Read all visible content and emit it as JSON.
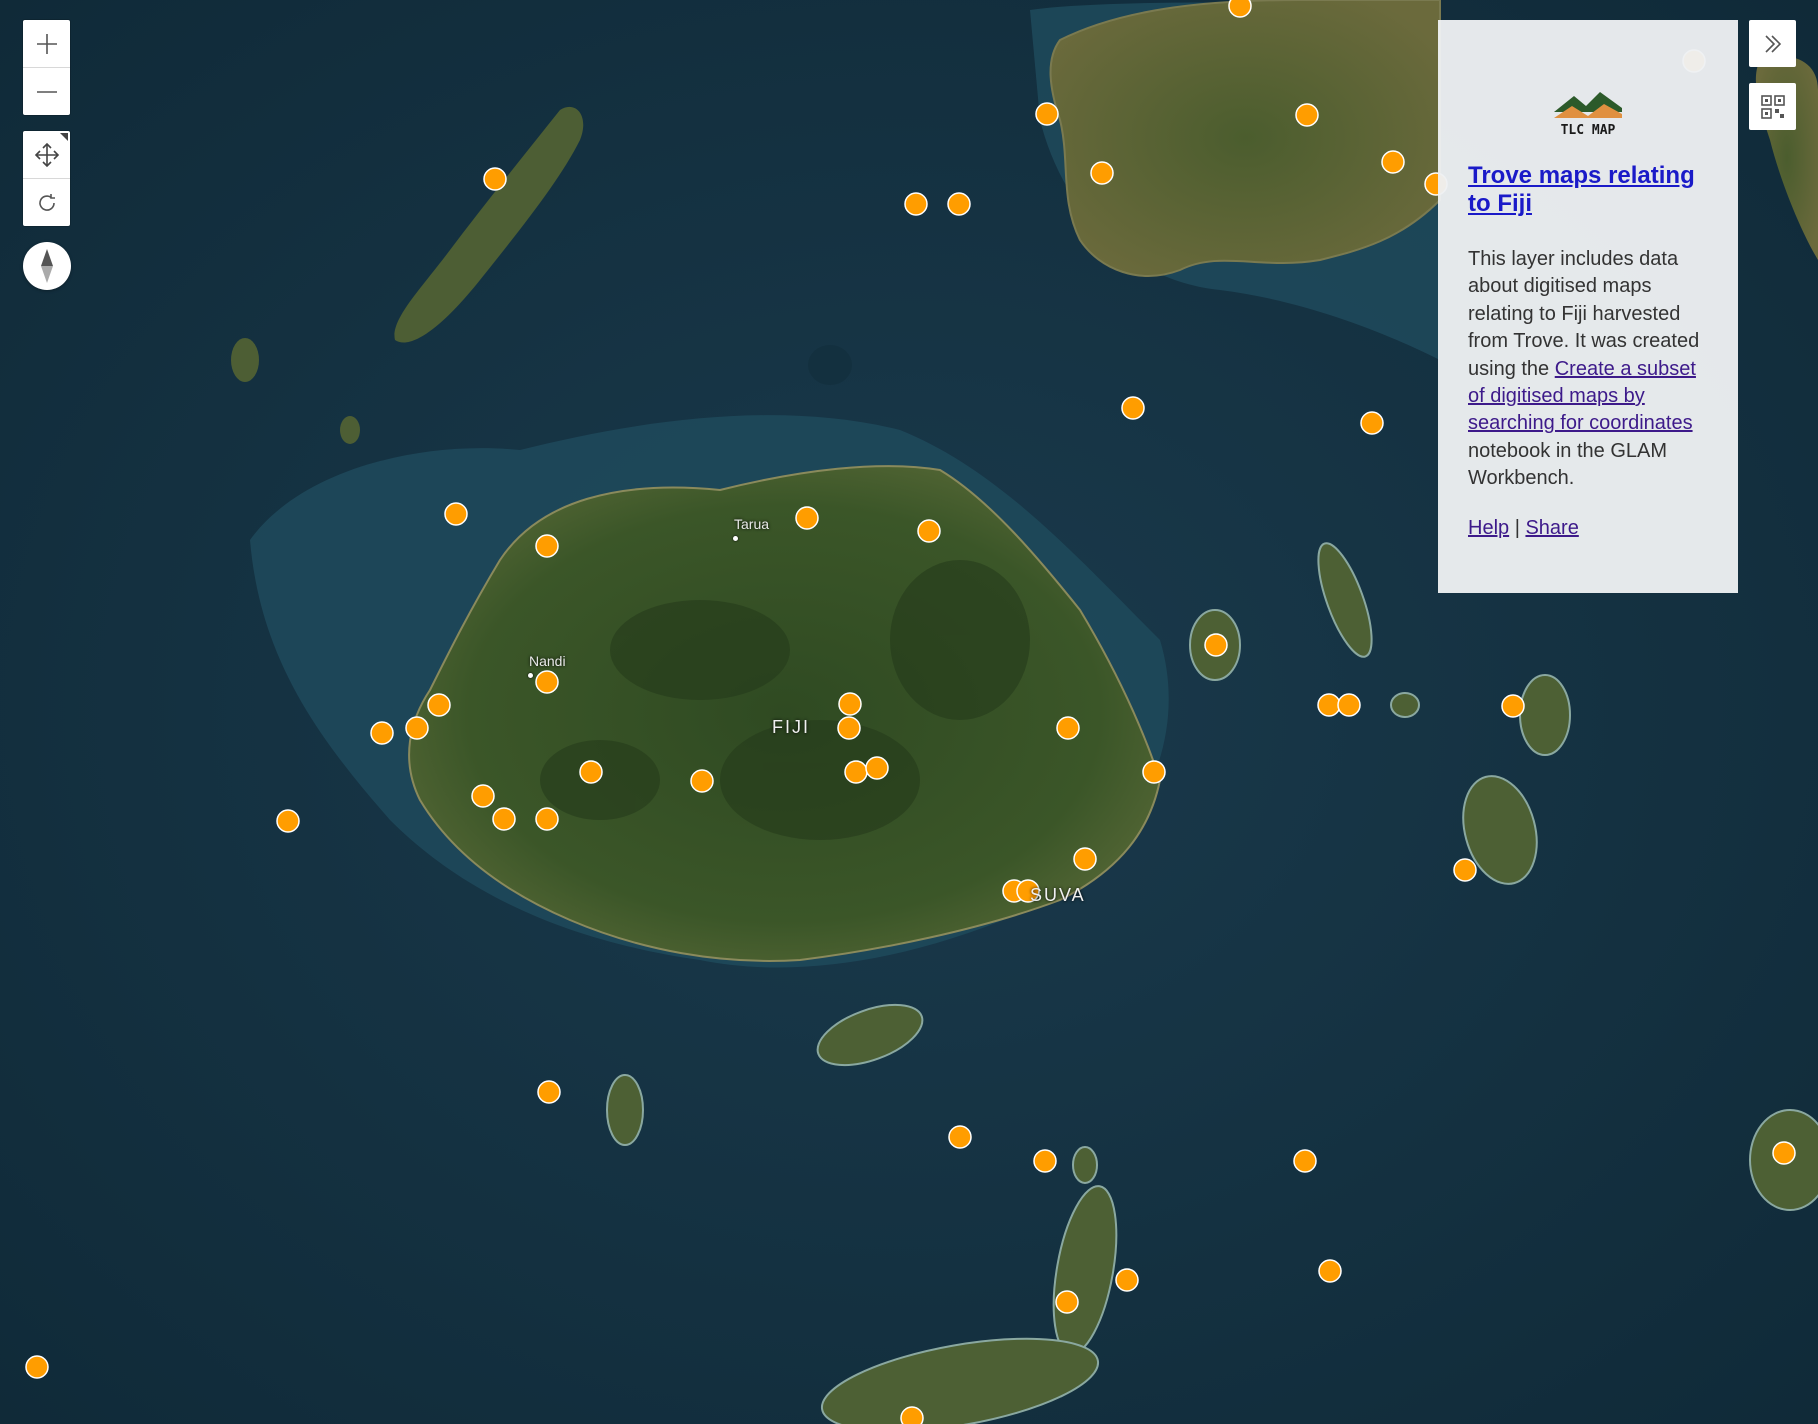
{
  "map": {
    "labels": {
      "tarua": "Tarua",
      "nandi": "Nandi",
      "fiji": "FIJI",
      "suva": "SUVA"
    },
    "marker_color": "#ff9d00",
    "marker_count": 53
  },
  "controls": {
    "zoom_in_icon": "plus-icon",
    "zoom_out_icon": "minus-icon",
    "pan_icon": "move-arrows-icon",
    "rotate_icon": "rotate-icon",
    "compass_icon": "compass-needle-icon",
    "collapse_icon": "double-chevron-right-icon",
    "qr_icon": "qr-code-icon"
  },
  "panel": {
    "logo_text": "TLC MAP",
    "title": "Trove maps relating to Fiji",
    "desc_before": "This layer includes data about digitised maps relating to Fiji harvested from Trove. It was created using the ",
    "desc_link": "Create a subset of digitised maps by searching for coordinates",
    "desc_after": " notebook in the GLAM Workbench.",
    "help": "Help",
    "separator": " | ",
    "share": "Share"
  }
}
